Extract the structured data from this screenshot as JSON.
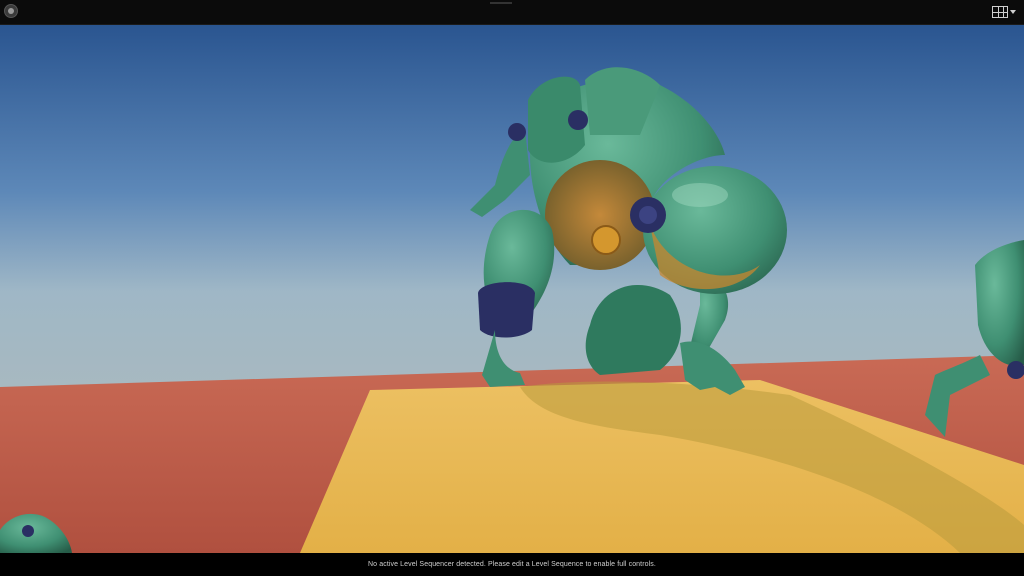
{
  "viewport": {
    "sky_top_color": "#2d5a94",
    "sky_horizon_color": "#9fb3bf",
    "floor_color": "#b85a4a",
    "platform_color": "#e8b84e",
    "robot_color": "#3f8f72",
    "robot_joint_color": "#2a2f63"
  },
  "toolbar": {
    "record_icon": "record-icon",
    "layout_icon": "viewport-layout-icon"
  },
  "status": {
    "message": "No active Level Sequencer detected. Please edit a Level Sequence to enable full controls."
  }
}
